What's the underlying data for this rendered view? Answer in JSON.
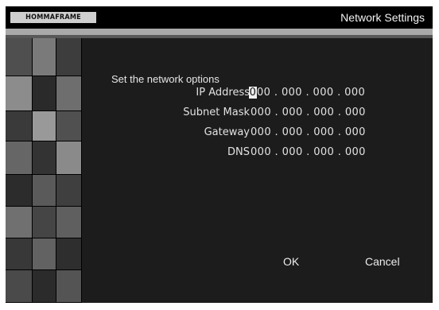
{
  "window": {
    "logo_text": "HOMMAFRAME",
    "title": "Network Settings"
  },
  "form": {
    "prompt": "Set the network options",
    "fields": [
      {
        "label": "IP Address",
        "value": "000 . 000 . 000 . 000"
      },
      {
        "label": "Subnet Mask",
        "value": "000 . 000 . 000 . 000"
      },
      {
        "label": "Gateway",
        "value": "000 . 000 . 000 . 000"
      },
      {
        "label": "DNS",
        "value": "000 . 000 . 000 . 000"
      }
    ]
  },
  "buttons": {
    "ok": "OK",
    "cancel": "Cancel"
  },
  "colors": {
    "background": "#1c1c1c",
    "titlebar": "#000000",
    "text": "#e6e6e6",
    "cursor": "#efefef"
  }
}
